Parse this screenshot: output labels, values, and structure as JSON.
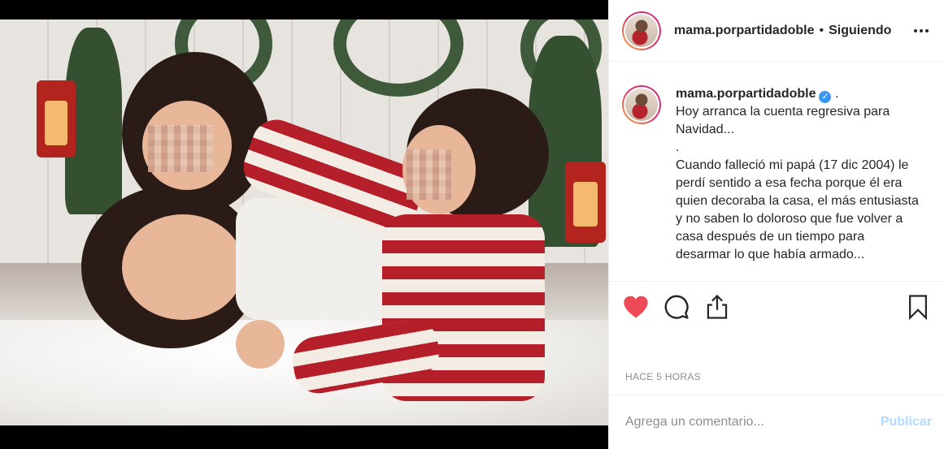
{
  "header": {
    "username": "mama.porpartidadoble",
    "separator": "•",
    "follow_status": "Siguiendo"
  },
  "caption": {
    "username": "mama.porpartidadoble",
    "verified_mark": "✓",
    "trailing": ".",
    "text": "Hoy arranca la cuenta regresiva para Navidad...\n.\nCuando falleció mi papá (17 dic 2004) le perdí sentido a esa fecha porque él era quien decoraba la casa, el más entusiasta y no saben lo doloroso que fue volver a casa después de un tiempo para desarmar lo que había armado..."
  },
  "actions": {
    "like_icon": "heart-filled-icon",
    "comment_icon": "comment-icon",
    "share_icon": "share-icon",
    "save_icon": "bookmark-icon",
    "like_color": "#ed4956"
  },
  "timestamp": "HACE 5 HORAS",
  "comment_form": {
    "placeholder": "Agrega un comentario...",
    "publish_label": "Publicar"
  }
}
